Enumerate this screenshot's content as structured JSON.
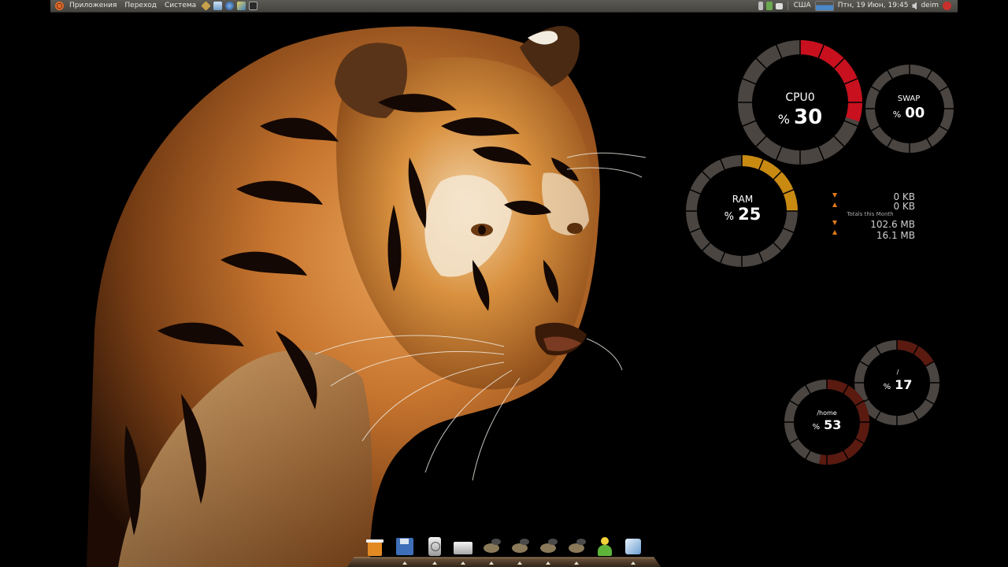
{
  "top_panel": {
    "menus": [
      "Приложения",
      "Переход",
      "Система"
    ],
    "keyboard_layout": "США",
    "clock": "Птн, 19 Июн, 19:45",
    "user": "deim"
  },
  "conky": {
    "cpu": {
      "label": "CPU0",
      "prefix": "%",
      "value": "30",
      "percent": 30
    },
    "swap": {
      "label": "SWAP",
      "prefix": "%",
      "value": "00",
      "percent": 0
    },
    "ram": {
      "label": "RAM",
      "prefix": "%",
      "value": "25",
      "percent": 25
    },
    "root": {
      "label": "/",
      "prefix": "%",
      "value": "17",
      "percent": 17
    },
    "home": {
      "label": "/home",
      "prefix": "%",
      "value": "53",
      "percent": 53
    },
    "network": {
      "down_now": "0 KB",
      "up_now": "0 KB",
      "totals_label": "Totals this Month",
      "down_total": "102.6 MB",
      "up_total": "16.1 MB"
    }
  },
  "colors": {
    "cpu_accent": "#c8101e",
    "ram_accent": "#c98a12",
    "swap_accent": "#7a4a10",
    "disk_accent": "#5a1a10",
    "ring_base": "#4a4541"
  },
  "dock": {
    "icons": [
      "trash-icon",
      "floppy-icon",
      "hard-disk-icon",
      "drive-icon",
      "gimp-icon",
      "gimp-icon",
      "gimp-icon",
      "gimp-icon",
      "user-icon",
      "box-icon"
    ]
  }
}
